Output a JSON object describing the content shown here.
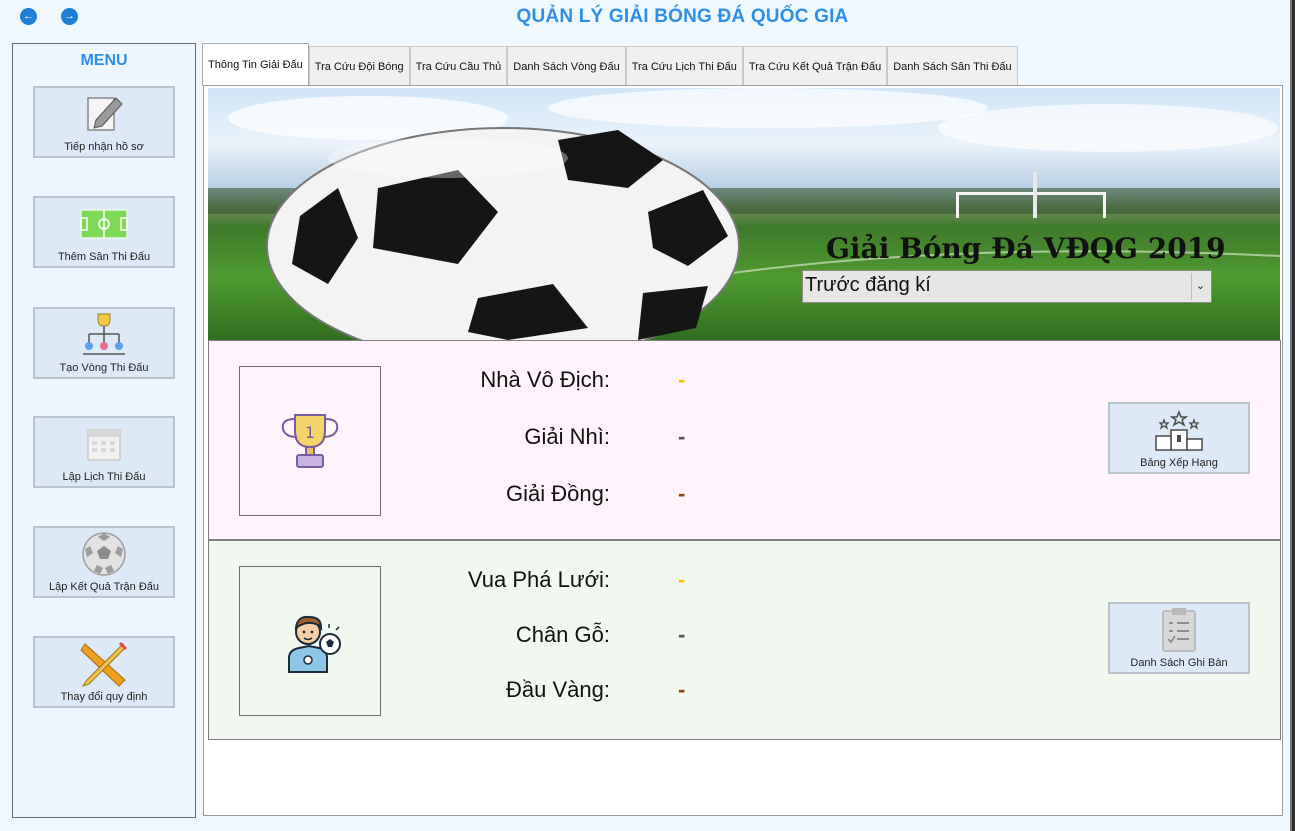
{
  "window": {
    "title": "QUẢN LÝ GIẢI BÓNG ĐÁ QUỐC GIA",
    "back_icon": "arrow-left-icon",
    "forward_icon": "arrow-right-icon"
  },
  "sidebar": {
    "title": "MENU",
    "items": [
      {
        "label": "Tiếp nhận hồ sơ",
        "icon": "pencil-paper-icon"
      },
      {
        "label": "Thêm Sân Thi Đấu",
        "icon": "pitch-icon"
      },
      {
        "label": "Tạo Vòng Thi Đấu",
        "icon": "tournament-bracket-icon"
      },
      {
        "label": "Lập Lịch Thi Đấu",
        "icon": "calendar-icon"
      },
      {
        "label": "Lập Kết Quả Trận Đấu",
        "icon": "soccer-ball-icon"
      },
      {
        "label": "Thay đổi quy định",
        "icon": "pencil-ruler-icon"
      }
    ]
  },
  "tabs": [
    {
      "label": "Thông Tin Giải Đấu",
      "active": true
    },
    {
      "label": "Tra Cứu Đội Bóng"
    },
    {
      "label": "Tra Cứu Cầu Thủ"
    },
    {
      "label": "Danh Sách Vòng Đấu"
    },
    {
      "label": "Tra Cứu Lịch Thi Đấu"
    },
    {
      "label": "Tra Cứu Kết Quả Trận Đấu"
    },
    {
      "label": "Danh Sách Sân Thi Đấu"
    }
  ],
  "banner": {
    "title": "Giải Bóng Đá VĐQG 2019",
    "season_select": {
      "value": "Trước đăng kí"
    }
  },
  "awards": {
    "champion": {
      "label": "Nhà Vô Địch:",
      "value": "-"
    },
    "runner_up": {
      "label": "Giải Nhì:",
      "value": "-"
    },
    "third": {
      "label": "Giải Đồng:",
      "value": "-"
    },
    "button_label": "Bảng Xếp Hạng"
  },
  "players": {
    "top_scorer": {
      "label": "Vua Phá Lưới:",
      "value": "-"
    },
    "wooden_foot": {
      "label": "Chân Gỗ:",
      "value": "-"
    },
    "golden_head": {
      "label": "Đầu Vàng:",
      "value": "-"
    },
    "button_label": "Danh Sách Ghi Bàn"
  },
  "colors": {
    "accent": "#2e8fe6",
    "gold": "#f5c400",
    "silver": "#555555",
    "bronze": "#8b4513"
  }
}
